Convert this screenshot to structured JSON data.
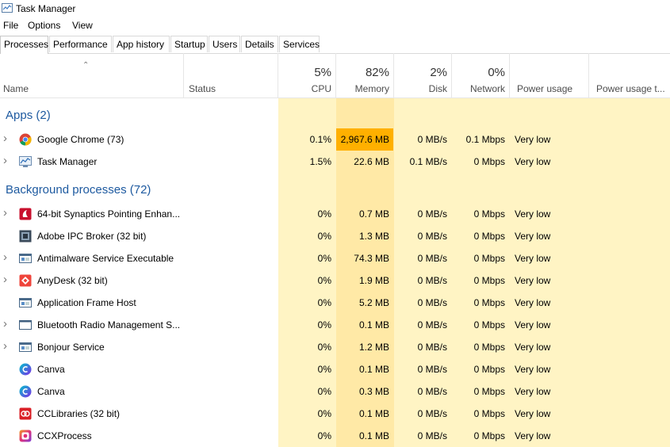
{
  "window": {
    "title": "Task Manager"
  },
  "menu": [
    "File",
    "Options",
    "View"
  ],
  "tabs": [
    "Processes",
    "Performance",
    "App history",
    "Startup",
    "Users",
    "Details",
    "Services"
  ],
  "columns": {
    "name": "Name",
    "status": "Status",
    "cpu": {
      "pct": "5%",
      "label": "CPU"
    },
    "memory": {
      "pct": "82%",
      "label": "Memory"
    },
    "disk": {
      "pct": "2%",
      "label": "Disk"
    },
    "network": {
      "pct": "0%",
      "label": "Network"
    },
    "power": "Power usage",
    "power_trend": "Power usage t..."
  },
  "colors": {
    "light_yellow": "#fff4c4",
    "yellow": "#ffedb0",
    "mem_yellow": "#ffe6a0",
    "highlight_orange": "#ffb000",
    "group_blue": "#1e5aa0"
  },
  "apps": {
    "header": "Apps (2)",
    "rows": [
      {
        "name": "Google Chrome (73)",
        "icon": "chrome-icon",
        "expandable": true,
        "cpu": "0.1%",
        "memory": "2,967.6 MB",
        "disk": "0 MB/s",
        "network": "0.1 Mbps",
        "power": "Very low",
        "mem_highlight": true
      },
      {
        "name": "Task Manager",
        "icon": "task-manager-icon",
        "expandable": true,
        "cpu": "1.5%",
        "memory": "22.6 MB",
        "disk": "0.1 MB/s",
        "network": "0 Mbps",
        "power": "Very low",
        "mem_highlight": false
      }
    ]
  },
  "background": {
    "header": "Background processes (72)",
    "rows": [
      {
        "name": "64-bit Synaptics Pointing Enhan...",
        "icon": "synaptics-icon",
        "expandable": true,
        "cpu": "0%",
        "memory": "0.7 MB",
        "disk": "0 MB/s",
        "network": "0 Mbps",
        "power": "Very low"
      },
      {
        "name": "Adobe IPC Broker (32 bit)",
        "icon": "adobe-ipc-icon",
        "expandable": false,
        "cpu": "0%",
        "memory": "1.3 MB",
        "disk": "0 MB/s",
        "network": "0 Mbps",
        "power": "Very low"
      },
      {
        "name": "Antimalware Service Executable",
        "icon": "service-window-icon",
        "expandable": true,
        "cpu": "0%",
        "memory": "74.3 MB",
        "disk": "0 MB/s",
        "network": "0 Mbps",
        "power": "Very low"
      },
      {
        "name": "AnyDesk (32 bit)",
        "icon": "anydesk-icon",
        "expandable": true,
        "cpu": "0%",
        "memory": "1.9 MB",
        "disk": "0 MB/s",
        "network": "0 Mbps",
        "power": "Very low"
      },
      {
        "name": "Application Frame Host",
        "icon": "service-window-icon",
        "expandable": false,
        "cpu": "0%",
        "memory": "5.2 MB",
        "disk": "0 MB/s",
        "network": "0 Mbps",
        "power": "Very low"
      },
      {
        "name": "Bluetooth Radio Management S...",
        "icon": "window-icon",
        "expandable": true,
        "cpu": "0%",
        "memory": "0.1 MB",
        "disk": "0 MB/s",
        "network": "0 Mbps",
        "power": "Very low"
      },
      {
        "name": "Bonjour Service",
        "icon": "service-window-icon",
        "expandable": true,
        "cpu": "0%",
        "memory": "1.2 MB",
        "disk": "0 MB/s",
        "network": "0 Mbps",
        "power": "Very low"
      },
      {
        "name": "Canva",
        "icon": "canva-icon",
        "expandable": false,
        "cpu": "0%",
        "memory": "0.1 MB",
        "disk": "0 MB/s",
        "network": "0 Mbps",
        "power": "Very low"
      },
      {
        "name": "Canva",
        "icon": "canva-icon",
        "expandable": false,
        "cpu": "0%",
        "memory": "0.3 MB",
        "disk": "0 MB/s",
        "network": "0 Mbps",
        "power": "Very low"
      },
      {
        "name": "CCLibraries (32 bit)",
        "icon": "cclibraries-icon",
        "expandable": false,
        "cpu": "0%",
        "memory": "0.1 MB",
        "disk": "0 MB/s",
        "network": "0 Mbps",
        "power": "Very low"
      },
      {
        "name": "CCXProcess",
        "icon": "ccxprocess-icon",
        "expandable": false,
        "cpu": "0%",
        "memory": "0.1 MB",
        "disk": "0 MB/s",
        "network": "0 Mbps",
        "power": "Very low"
      }
    ]
  }
}
